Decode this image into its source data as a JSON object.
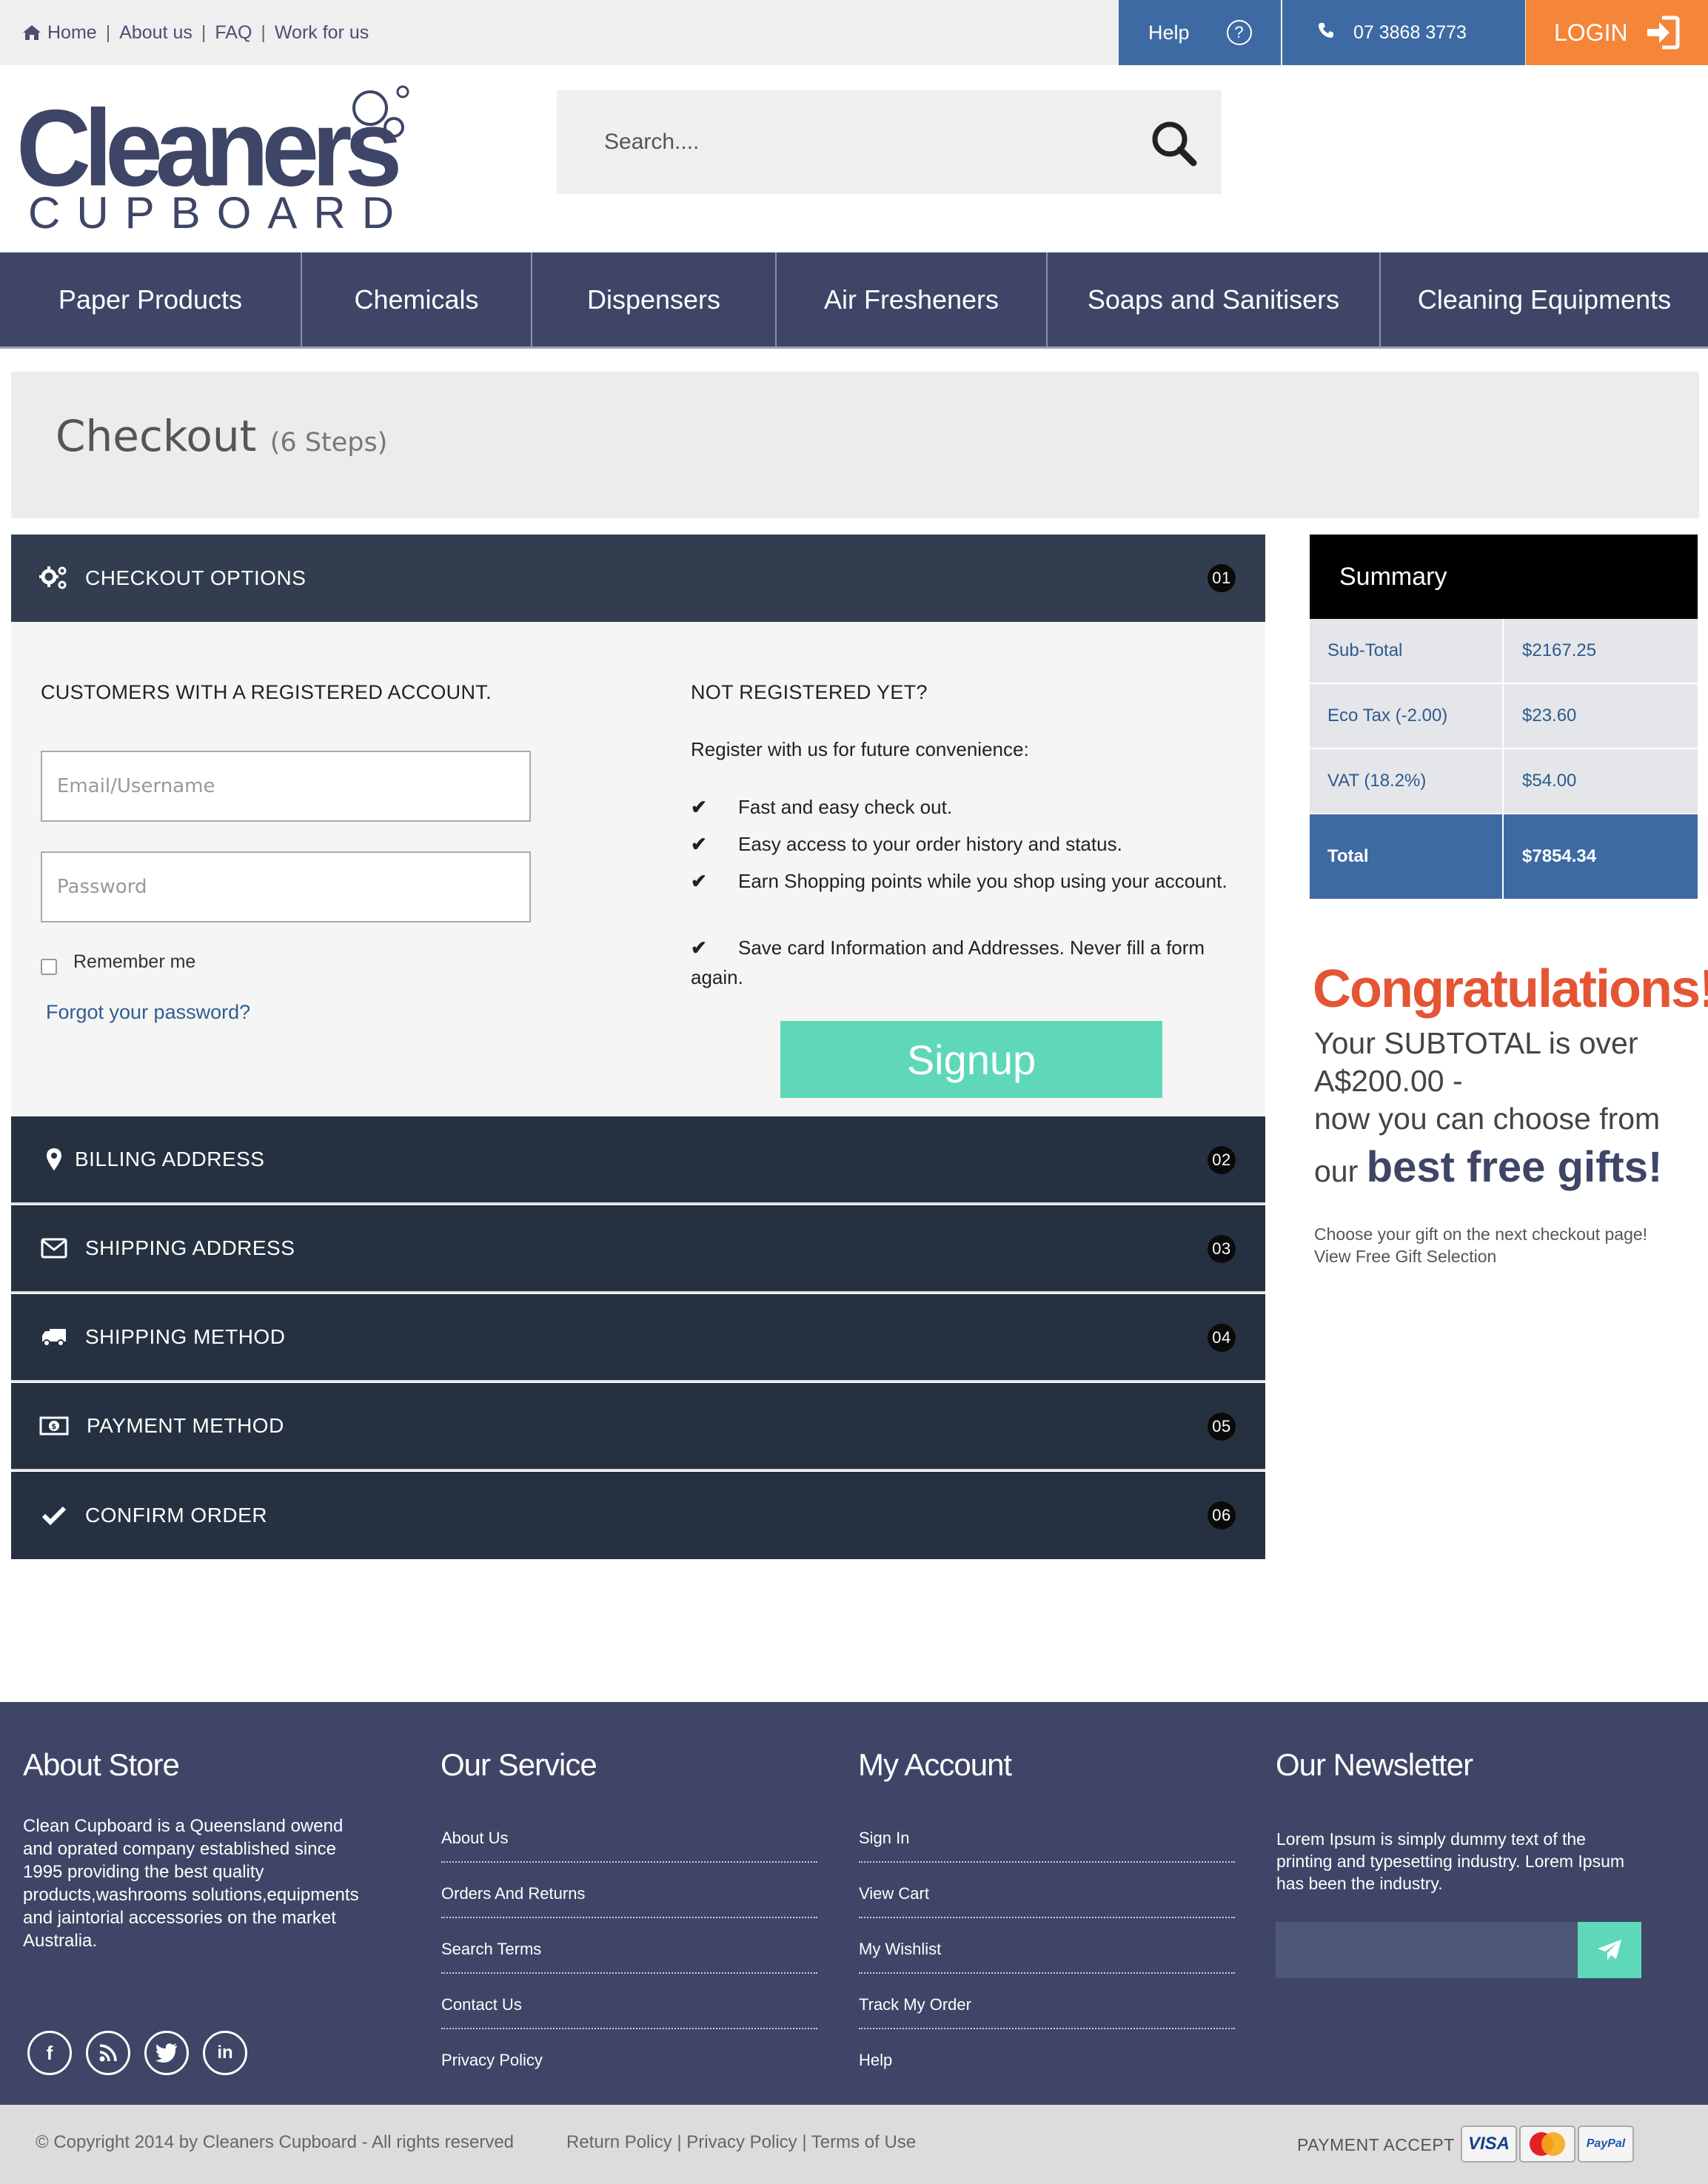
{
  "topbar": {
    "links": [
      "Home",
      "About us",
      "FAQ",
      "Work for us"
    ],
    "help_label": "Help",
    "help_icon": "?",
    "phone": "07 3868 3773",
    "login_label": "LOGIN"
  },
  "logo": {
    "main": "Cleaners",
    "sub": "CUPBOARD"
  },
  "search": {
    "placeholder": "Search...."
  },
  "nav": [
    "Paper Products",
    "Chemicals",
    "Dispensers",
    "Air Fresheners",
    "Soaps and Sanitisers",
    "Cleaning Equipments"
  ],
  "page": {
    "title": "Checkout",
    "steps_note": "(6 Steps)"
  },
  "steps": [
    {
      "label": "CHECKOUT OPTIONS",
      "num": "01",
      "icon": "gears-icon"
    },
    {
      "label": "BILLING ADDRESS",
      "num": "02",
      "icon": "map-pin-icon"
    },
    {
      "label": "SHIPPING ADDRESS",
      "num": "03",
      "icon": "envelope-icon"
    },
    {
      "label": "SHIPPING METHOD",
      "num": "04",
      "icon": "truck-icon"
    },
    {
      "label": "PAYMENT METHOD",
      "num": "05",
      "icon": "money-icon"
    },
    {
      "label": "CONFIRM ORDER",
      "num": "06",
      "icon": "check-icon"
    }
  ],
  "login_form": {
    "heading": "CUSTOMERS WITH A REGISTERED ACCOUNT.",
    "email_placeholder": "Email/Username",
    "password_placeholder": "Password",
    "remember": "Remember me",
    "forgot": "Forgot your password?"
  },
  "register": {
    "heading": "NOT REGISTERED YET?",
    "intro": "Register with us for future convenience:",
    "benefits": [
      "Fast and easy check out.",
      "Easy access to your order history and status.",
      "Earn Shopping points while you shop using your account.",
      "Save card Information and Addresses. Never fill a form again."
    ],
    "signup": "Signup"
  },
  "summary": {
    "title": "Summary",
    "rows": [
      {
        "label": "Sub-Total",
        "value": "$2167.25"
      },
      {
        "label": "Eco Tax (-2.00)",
        "value": "$23.60"
      },
      {
        "label": "VAT (18.2%)",
        "value": "$54.00"
      }
    ],
    "total_label": "Total",
    "total_value": "$7854.34"
  },
  "promo": {
    "headline": "Congratulations!",
    "line1": "Your SUBTOTAL is over",
    "line2": "A$200.00 -",
    "line3": "now you can choose from",
    "line4_prefix": "our",
    "line4_bold": "best free gifts!",
    "small1": "Choose your gift on the next checkout page!",
    "small2": "View Free Gift Selection"
  },
  "footer": {
    "about_title": "About Store",
    "about_lines": [
      "Clean Cupboard is a Queensland owend",
      "and oprated  company established since",
      "1995 providing the best quality",
      "products,washrooms solutions,equipments",
      "and jaintorial accessories on the market",
      "Australia."
    ],
    "service_title": "Our Service",
    "service_links": [
      "About Us",
      "Orders And Returns",
      "Search Terms",
      "Contact Us",
      "Privacy Policy"
    ],
    "account_title": "My Account",
    "account_links": [
      "Sign In",
      "View Cart",
      "My Wishlist",
      "Track My Order",
      "Help"
    ],
    "newsletter_title": "Our Newsletter",
    "newsletter_lines": [
      "Lorem Ipsum is simply dummy text of the",
      "printing and typesetting industry. Lorem Ipsum",
      "has been the industry."
    ],
    "social": [
      "f",
      "rss",
      "t",
      "in"
    ]
  },
  "bottom": {
    "copyright": "© Copyright 2014 by Cleaners Cupboard - All rights reserved",
    "policies": "Return Policy | Privacy Policy | Terms of Use",
    "payment_accept": "PAYMENT ACCEPT",
    "cards": [
      "VISA",
      "MasterCard",
      "PayPal"
    ]
  },
  "colors": {
    "navy": "#3e4566",
    "blue": "#3e6aa3",
    "orange": "#f58538",
    "mint": "#5ed8b8",
    "step_dark": "#253141",
    "promo_red": "#e55533"
  }
}
